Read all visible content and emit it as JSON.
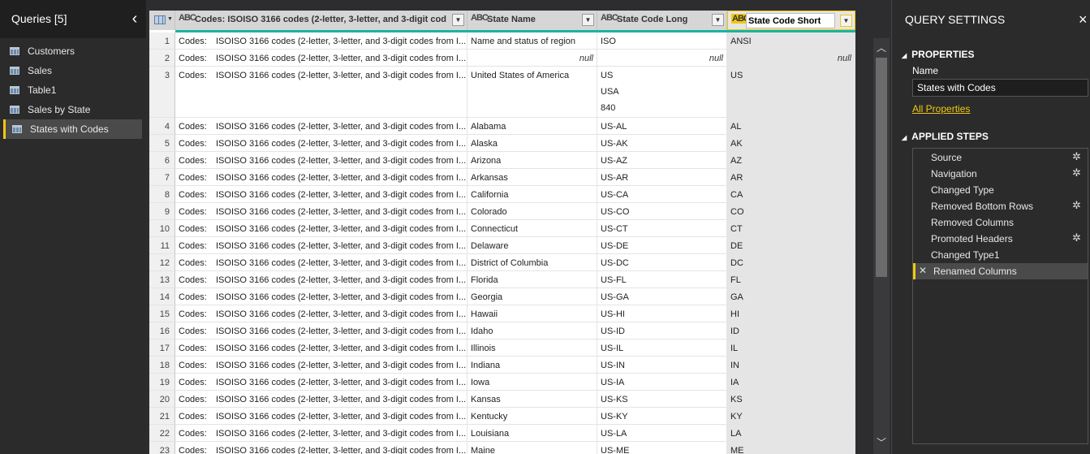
{
  "queries_pane": {
    "title": "Queries [5]",
    "collapse_glyph": "‹",
    "items": [
      {
        "label": "Customers",
        "icon": "table-icon",
        "selected": false
      },
      {
        "label": "Sales",
        "icon": "table-icon",
        "selected": false
      },
      {
        "label": "Table1",
        "icon": "table-icon",
        "selected": false
      },
      {
        "label": "Sales by State",
        "icon": "table-icon",
        "selected": false
      },
      {
        "label": "States with Codes",
        "icon": "table-icon",
        "selected": true
      }
    ]
  },
  "grid": {
    "columns": [
      {
        "type": "ABC",
        "label": "Codes:   ISOISO 3166 codes (2-letter, 3-letter, and 3-digit cod..."
      },
      {
        "type": "ABC",
        "label": "State Name"
      },
      {
        "type": "ABC",
        "label": "State Code Long"
      },
      {
        "type": "ABC",
        "label": "State Code Short"
      }
    ],
    "null_text": "null",
    "rows": [
      {
        "n": "1",
        "c1": "Codes:",
        "c1b": "ISOISO 3166 codes (2-letter, 3-letter, and 3-digit codes from I...",
        "c2": "Name and status of region",
        "c3": "ISO",
        "c4": "ANSI"
      },
      {
        "n": "2",
        "c1": "Codes:",
        "c1b": "ISOISO 3166 codes (2-letter, 3-letter, and 3-digit codes from I...",
        "c2": "null",
        "c3": "null",
        "c4": "null"
      },
      {
        "n": "3",
        "c1": "Codes:",
        "c1b": "ISOISO 3166 codes (2-letter, 3-letter, and 3-digit codes from I...",
        "c2": "United States of America",
        "c3": "US",
        "c3b": "USA",
        "c3c": "840",
        "c4": "US"
      },
      {
        "n": "4",
        "c1": "Codes:",
        "c1b": "ISOISO 3166 codes (2-letter, 3-letter, and 3-digit codes from I...",
        "c2": "Alabama",
        "c3": "US-AL",
        "c4": "AL"
      },
      {
        "n": "5",
        "c1": "Codes:",
        "c1b": "ISOISO 3166 codes (2-letter, 3-letter, and 3-digit codes from I...",
        "c2": "Alaska",
        "c3": "US-AK",
        "c4": "AK"
      },
      {
        "n": "6",
        "c1": "Codes:",
        "c1b": "ISOISO 3166 codes (2-letter, 3-letter, and 3-digit codes from I...",
        "c2": "Arizona",
        "c3": "US-AZ",
        "c4": "AZ"
      },
      {
        "n": "7",
        "c1": "Codes:",
        "c1b": "ISOISO 3166 codes (2-letter, 3-letter, and 3-digit codes from I...",
        "c2": "Arkansas",
        "c3": "US-AR",
        "c4": "AR"
      },
      {
        "n": "8",
        "c1": "Codes:",
        "c1b": "ISOISO 3166 codes (2-letter, 3-letter, and 3-digit codes from I...",
        "c2": "California",
        "c3": "US-CA",
        "c4": "CA"
      },
      {
        "n": "9",
        "c1": "Codes:",
        "c1b": "ISOISO 3166 codes (2-letter, 3-letter, and 3-digit codes from I...",
        "c2": "Colorado",
        "c3": "US-CO",
        "c4": "CO"
      },
      {
        "n": "10",
        "c1": "Codes:",
        "c1b": "ISOISO 3166 codes (2-letter, 3-letter, and 3-digit codes from I...",
        "c2": "Connecticut",
        "c3": "US-CT",
        "c4": "CT"
      },
      {
        "n": "11",
        "c1": "Codes:",
        "c1b": "ISOISO 3166 codes (2-letter, 3-letter, and 3-digit codes from I...",
        "c2": "Delaware",
        "c3": "US-DE",
        "c4": "DE"
      },
      {
        "n": "12",
        "c1": "Codes:",
        "c1b": "ISOISO 3166 codes (2-letter, 3-letter, and 3-digit codes from I...",
        "c2": "District of Columbia",
        "c3": "US-DC",
        "c4": "DC"
      },
      {
        "n": "13",
        "c1": "Codes:",
        "c1b": "ISOISO 3166 codes (2-letter, 3-letter, and 3-digit codes from I...",
        "c2": "Florida",
        "c3": "US-FL",
        "c4": "FL"
      },
      {
        "n": "14",
        "c1": "Codes:",
        "c1b": "ISOISO 3166 codes (2-letter, 3-letter, and 3-digit codes from I...",
        "c2": "Georgia",
        "c3": "US-GA",
        "c4": "GA"
      },
      {
        "n": "15",
        "c1": "Codes:",
        "c1b": "ISOISO 3166 codes (2-letter, 3-letter, and 3-digit codes from I...",
        "c2": "Hawaii",
        "c3": "US-HI",
        "c4": "HI"
      },
      {
        "n": "16",
        "c1": "Codes:",
        "c1b": "ISOISO 3166 codes (2-letter, 3-letter, and 3-digit codes from I...",
        "c2": "Idaho",
        "c3": "US-ID",
        "c4": "ID"
      },
      {
        "n": "17",
        "c1": "Codes:",
        "c1b": "ISOISO 3166 codes (2-letter, 3-letter, and 3-digit codes from I...",
        "c2": "Illinois",
        "c3": "US-IL",
        "c4": "IL"
      },
      {
        "n": "18",
        "c1": "Codes:",
        "c1b": "ISOISO 3166 codes (2-letter, 3-letter, and 3-digit codes from I...",
        "c2": "Indiana",
        "c3": "US-IN",
        "c4": "IN"
      },
      {
        "n": "19",
        "c1": "Codes:",
        "c1b": "ISOISO 3166 codes (2-letter, 3-letter, and 3-digit codes from I...",
        "c2": "Iowa",
        "c3": "US-IA",
        "c4": "IA"
      },
      {
        "n": "20",
        "c1": "Codes:",
        "c1b": "ISOISO 3166 codes (2-letter, 3-letter, and 3-digit codes from I...",
        "c2": "Kansas",
        "c3": "US-KS",
        "c4": "KS"
      },
      {
        "n": "21",
        "c1": "Codes:",
        "c1b": "ISOISO 3166 codes (2-letter, 3-letter, and 3-digit codes from I...",
        "c2": "Kentucky",
        "c3": "US-KY",
        "c4": "KY"
      },
      {
        "n": "22",
        "c1": "Codes:",
        "c1b": "ISOISO 3166 codes (2-letter, 3-letter, and 3-digit codes from I...",
        "c2": "Louisiana",
        "c3": "US-LA",
        "c4": "LA"
      },
      {
        "n": "23",
        "c1": "Codes:",
        "c1b": "ISOISO 3166 codes (2-letter, 3-letter, and 3-digit codes from I...",
        "c2": "Maine",
        "c3": "US-ME",
        "c4": "ME"
      }
    ]
  },
  "settings_pane": {
    "title": "QUERY SETTINGS",
    "close_glyph": "×",
    "properties_heading": "PROPERTIES",
    "name_label": "Name",
    "name_value": "States with Codes",
    "all_properties_link": "All Properties",
    "applied_steps_heading": "APPLIED STEPS",
    "steps": [
      {
        "label": "Source",
        "has_gear": true,
        "selected": false
      },
      {
        "label": "Navigation",
        "has_gear": true,
        "selected": false
      },
      {
        "label": "Changed Type",
        "has_gear": false,
        "selected": false
      },
      {
        "label": "Removed Bottom Rows",
        "has_gear": true,
        "selected": false
      },
      {
        "label": "Removed Columns",
        "has_gear": false,
        "selected": false
      },
      {
        "label": "Promoted Headers",
        "has_gear": true,
        "selected": false
      },
      {
        "label": "Changed Type1",
        "has_gear": false,
        "selected": false
      },
      {
        "label": "Renamed Columns",
        "has_gear": false,
        "selected": true
      }
    ]
  },
  "colors": {
    "accent": "#f2c811",
    "header_bar": "#1ab4a0",
    "pane_bg": "#2b2b2b"
  }
}
